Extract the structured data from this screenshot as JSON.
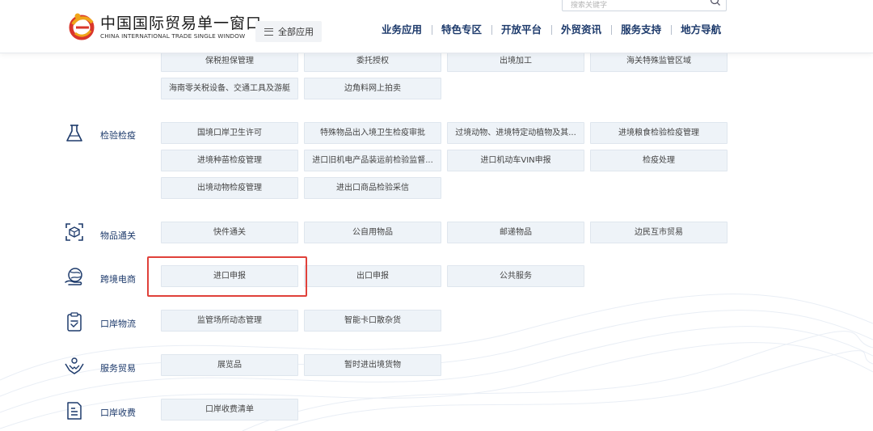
{
  "header": {
    "logo_cn": "中国国际贸易单一窗口",
    "logo_en": "CHINA INTERNATIONAL TRADE SINGLE WINDOW",
    "all_apps_label": "全部应用",
    "search_placeholder": "搜索关键字",
    "nav": [
      "业务应用",
      "特色专区",
      "开放平台",
      "外贸资讯",
      "服务支持",
      "地方导航"
    ]
  },
  "top_tiles": {
    "row1": [
      "保税担保管理",
      "委托授权",
      "出境加工",
      "海关特殊监管区域"
    ],
    "row2": [
      "海南零关税设备、交通工具及游艇",
      "边角料网上拍卖"
    ]
  },
  "sections": {
    "inspection": {
      "label": "检验检疫",
      "icon": "flask-icon",
      "row1": [
        "国境口岸卫生许可",
        "特殊物品出入境卫生检疫审批",
        "过境动物、进境特定动植物及其...",
        "进境粮食检验检疫管理"
      ],
      "row2": [
        "进境种苗检疫管理",
        "进口旧机电产品装运前检验监督...",
        "进口机动车VIN申报",
        "检疫处理"
      ],
      "row3": [
        "出境动物检疫管理",
        "进出口商品检验采信"
      ]
    },
    "goods": {
      "label": "物品通关",
      "icon": "package-scan-icon",
      "tiles": [
        "快件通关",
        "公自用物品",
        "邮递物品",
        "边民互市贸易"
      ]
    },
    "ecommerce": {
      "label": "跨境电商",
      "icon": "globe-hand-icon",
      "tiles": [
        "进口申报",
        "出口申报",
        "公共服务"
      ]
    },
    "logistics": {
      "label": "口岸物流",
      "icon": "clipboard-check-icon",
      "tiles": [
        "监管场所动态管理",
        "智能卡口散杂货"
      ]
    },
    "service": {
      "label": "服务贸易",
      "icon": "handshake-icon",
      "tiles": [
        "展览品",
        "暂时进出境货物"
      ]
    },
    "fees": {
      "label": "口岸收费",
      "icon": "document-list-icon",
      "tiles": [
        "口岸收费清单"
      ]
    }
  },
  "colors": {
    "nav": "#1d3a6b",
    "tile_bg": "#eef3f8",
    "highlight": "#e0413a"
  }
}
